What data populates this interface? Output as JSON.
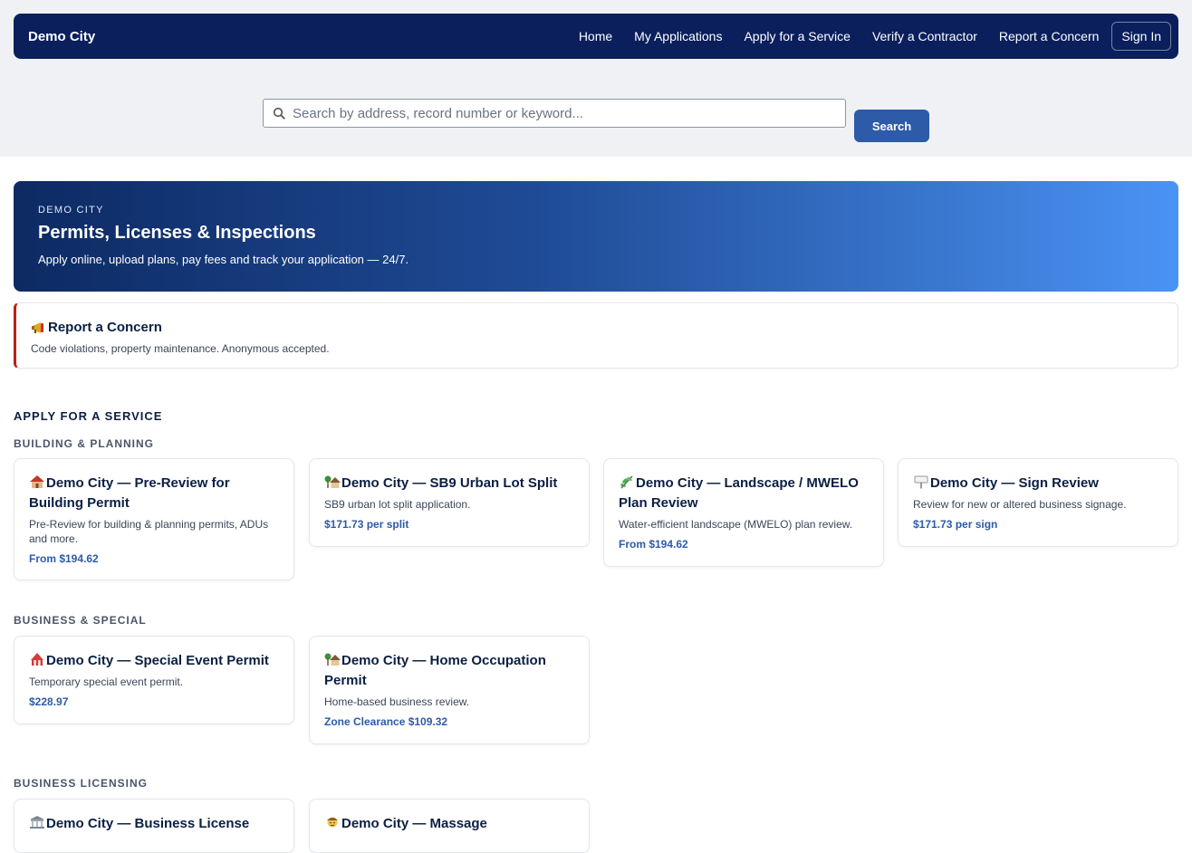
{
  "header": {
    "brand": "Demo City",
    "nav": [
      "Home",
      "My Applications",
      "Apply for a Service",
      "Verify a Contractor",
      "Report a Concern"
    ],
    "sign_in": "Sign In"
  },
  "search": {
    "placeholder": "Search by address, record number or keyword...",
    "button": "Search"
  },
  "hero": {
    "eyebrow": "DEMO CITY",
    "title": "Permits, Licenses & Inspections",
    "subtitle": "Apply online, upload plans, pay fees and track your application — 24/7."
  },
  "concern": {
    "icon": "megaphone-icon",
    "title": "Report a Concern",
    "description": "Code violations, property maintenance. Anonymous accepted."
  },
  "services": {
    "heading": "APPLY FOR A SERVICE",
    "groups": [
      {
        "name": "BUILDING & PLANNING",
        "cards": [
          {
            "icon": "house-icon",
            "title": "Demo City — Pre-Review for Building Permit",
            "desc": "Pre-Review for building & planning permits, ADUs and more.",
            "price": "From $194.62"
          },
          {
            "icon": "house-garden-icon",
            "title": "Demo City — SB9 Urban Lot Split",
            "desc": "SB9 urban lot split application.",
            "price": "$171.73 per split"
          },
          {
            "icon": "herb-icon",
            "title": "Demo City — Landscape / MWELO Plan Review",
            "desc": "Water-efficient landscape (MWELO) plan review.",
            "price": "From $194.62"
          },
          {
            "icon": "signpost-icon",
            "title": "Demo City — Sign Review",
            "desc": "Review for new or altered business signage.",
            "price": "$171.73 per sign"
          }
        ]
      },
      {
        "name": "BUSINESS & SPECIAL",
        "cards": [
          {
            "icon": "circus-tent-icon",
            "title": "Demo City — Special Event Permit",
            "desc": "Temporary special event permit.",
            "price": "$228.97"
          },
          {
            "icon": "house-garden-icon",
            "title": "Demo City — Home Occupation Permit",
            "desc": "Home-based business review.",
            "price": "Zone Clearance $109.32"
          }
        ]
      },
      {
        "name": "BUSINESS LICENSING",
        "cards": [
          {
            "icon": "bank-icon",
            "title": "Demo City — Business License",
            "desc": "",
            "price": ""
          },
          {
            "icon": "massage-icon",
            "title": "Demo City — Massage",
            "desc": "",
            "price": ""
          }
        ]
      }
    ]
  }
}
